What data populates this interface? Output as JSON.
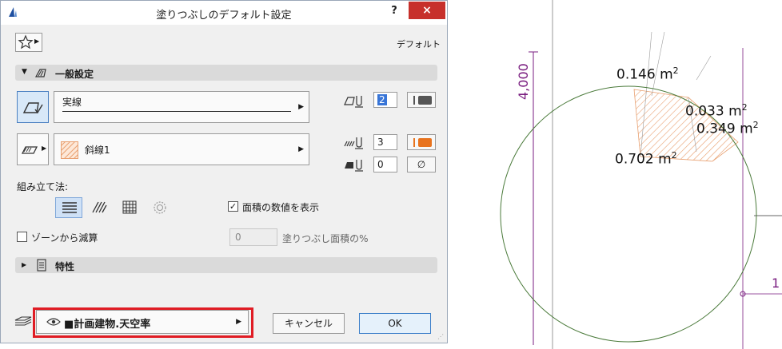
{
  "dialog": {
    "title": "塗りつぶしのデフォルト設定",
    "help": "?",
    "close": "×",
    "default_label": "デフォルト",
    "general_section": "一般設定",
    "line_type": "実線",
    "fill_pattern": "斜線1",
    "pen_fill_fg": "2",
    "pen_fill_bg": "3",
    "pen_bg": "0",
    "bg_symbol": "∅",
    "construction_label": "組み立て法:",
    "show_area_label": "面積の数値を表示",
    "show_area_checked": true,
    "subtract_zone_label": "ゾーンから減算",
    "subtract_zone_checked": false,
    "pct_value": "0",
    "pct_label": "塗りつぶし面積の%",
    "properties_section": "特性",
    "layer_value": "■計画建物.天空率",
    "cancel": "キャンセル",
    "ok": "OK",
    "colors": {
      "accent_orange": "#e8731e",
      "highlight_red": "#e01c24",
      "active_blue": "#4a7fc1"
    }
  },
  "drawing": {
    "dimension": "4,000",
    "areas": [
      "0.146",
      "0.033",
      "0.349",
      "0.702"
    ],
    "unit": "m",
    "unit_power": "2",
    "edge_digit": "1",
    "colors": {
      "hatch": "#e8a070",
      "circle": "#4a7a3a",
      "dim": "#7a1e80"
    }
  }
}
